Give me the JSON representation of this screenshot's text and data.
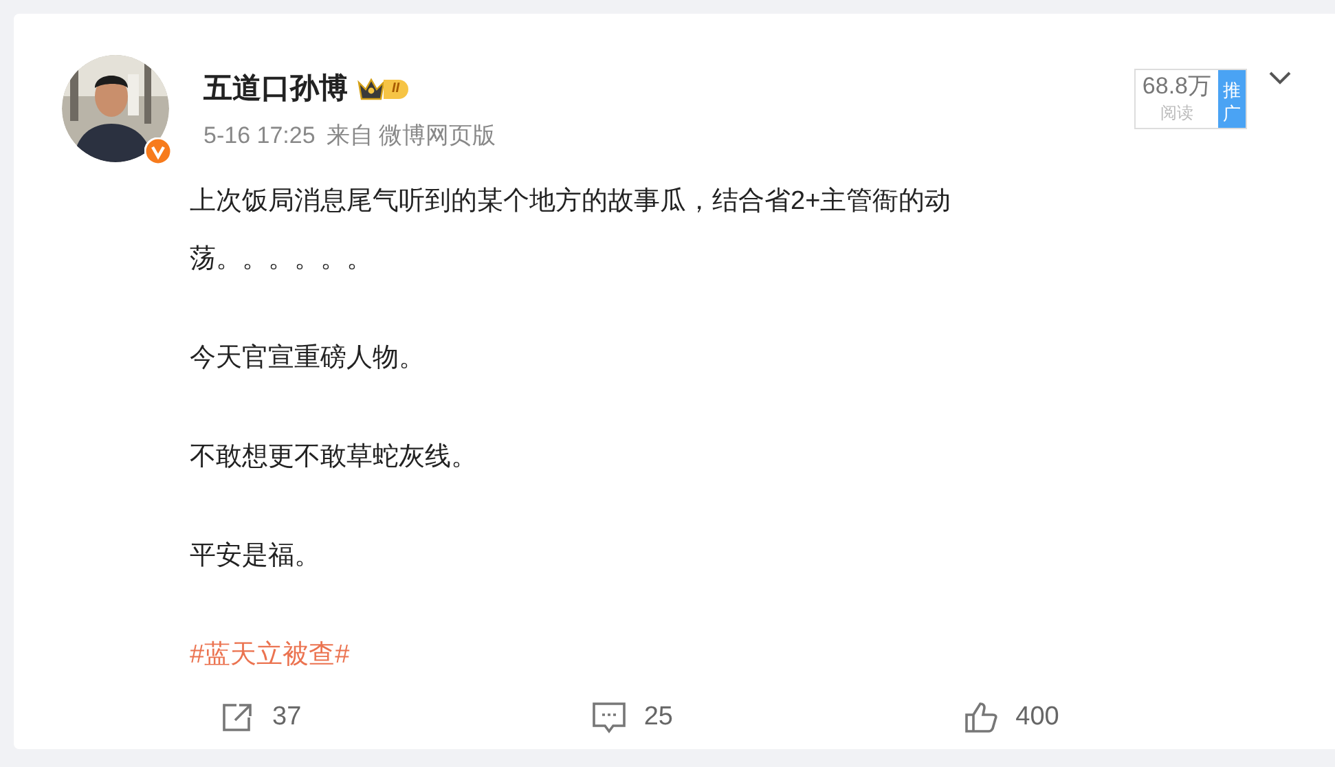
{
  "post": {
    "author": "五道口孙博",
    "level_badge": "II",
    "verified": true,
    "time": "5-16 17:25",
    "source_prefix": "来自",
    "source": "微博网页版",
    "views": {
      "count": "68.8万",
      "label": "阅读",
      "promote": "推广"
    },
    "paragraphs": [
      {
        "kind": "text",
        "text": "上次饭局消息尾气听到的某个地方的故事瓜，结合省2+主管衙的动荡。。。。。。"
      },
      {
        "kind": "text",
        "text": "今天官宣重磅人物。"
      },
      {
        "kind": "text",
        "text": "不敢想更不敢草蛇灰线。"
      },
      {
        "kind": "text",
        "text": "平安是福。"
      },
      {
        "kind": "hashtag",
        "text": "#蓝天立被查#"
      }
    ],
    "actions": [
      {
        "kind": "repost",
        "count": "37"
      },
      {
        "kind": "comment",
        "count": "25"
      },
      {
        "kind": "like",
        "count": "400"
      }
    ]
  }
}
